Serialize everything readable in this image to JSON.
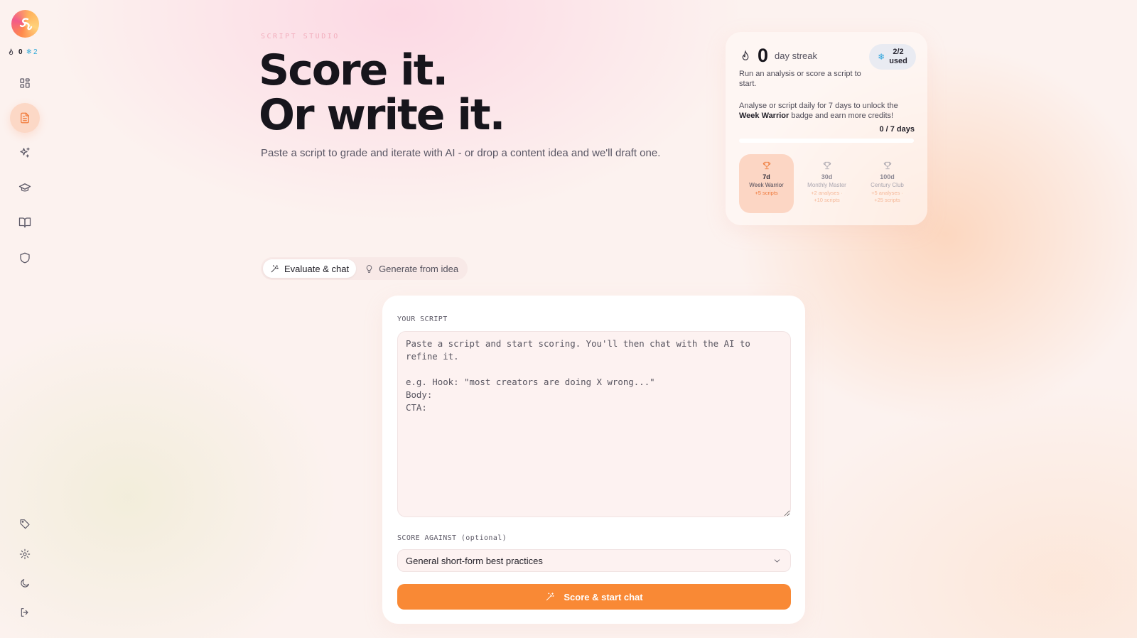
{
  "sidebar": {
    "streak_count": "0",
    "freeze_count": "2",
    "items": [
      {
        "name": "dashboard"
      },
      {
        "name": "scripts",
        "active": true
      },
      {
        "name": "sparkles"
      },
      {
        "name": "learn"
      },
      {
        "name": "library"
      },
      {
        "name": "shield"
      }
    ],
    "bottom_items": [
      {
        "name": "tag"
      },
      {
        "name": "settings"
      },
      {
        "name": "theme"
      },
      {
        "name": "logout"
      }
    ]
  },
  "hero": {
    "eyebrow": "SCRIPT STUDIO",
    "title_line1": "Score it.",
    "title_line2": "Or write it.",
    "subtitle": "Paste a script to grade and iterate with AI - or drop a content idea and we'll draft one."
  },
  "streak": {
    "count": "0",
    "label": "day streak",
    "freeze_used": "2/2",
    "freeze_used_label": "used",
    "description": "Run an analysis or score a script to start.",
    "goal_prefix": "Analyse or script daily for 7 days to unlock the",
    "goal_badge": "Week Warrior",
    "goal_suffix": "badge and earn more credits!",
    "progress_text": "0 / 7 days",
    "progress_fraction": 0,
    "badges": [
      {
        "days": "7d",
        "name": "Week Warrior",
        "reward": "+5 scripts",
        "active": true
      },
      {
        "days": "30d",
        "name": "Monthly Master",
        "reward_line1": "+2 analyses ·",
        "reward_line2": "+10 scripts",
        "active": false
      },
      {
        "days": "100d",
        "name": "Century Club",
        "reward_line1": "+5 analyses ·",
        "reward_line2": "+25 scripts",
        "active": false
      }
    ]
  },
  "tabs": [
    {
      "label": "Evaluate & chat",
      "active": true
    },
    {
      "label": "Generate from idea",
      "active": false
    }
  ],
  "form": {
    "script_label": "YOUR SCRIPT",
    "script_placeholder": "Paste a script and start scoring. You'll then chat with the AI to refine it.\n\ne.g. Hook: \"most creators are doing X wrong...\"\nBody:\nCTA:",
    "score_against_label": "SCORE AGAINST (optional)",
    "score_against_value": "General short-form best practices",
    "submit_label": "Score & start chat"
  },
  "colors": {
    "accent": "#f98935",
    "active_nav_bg": "#fcd8c6",
    "freeze": "#32a6dd"
  }
}
